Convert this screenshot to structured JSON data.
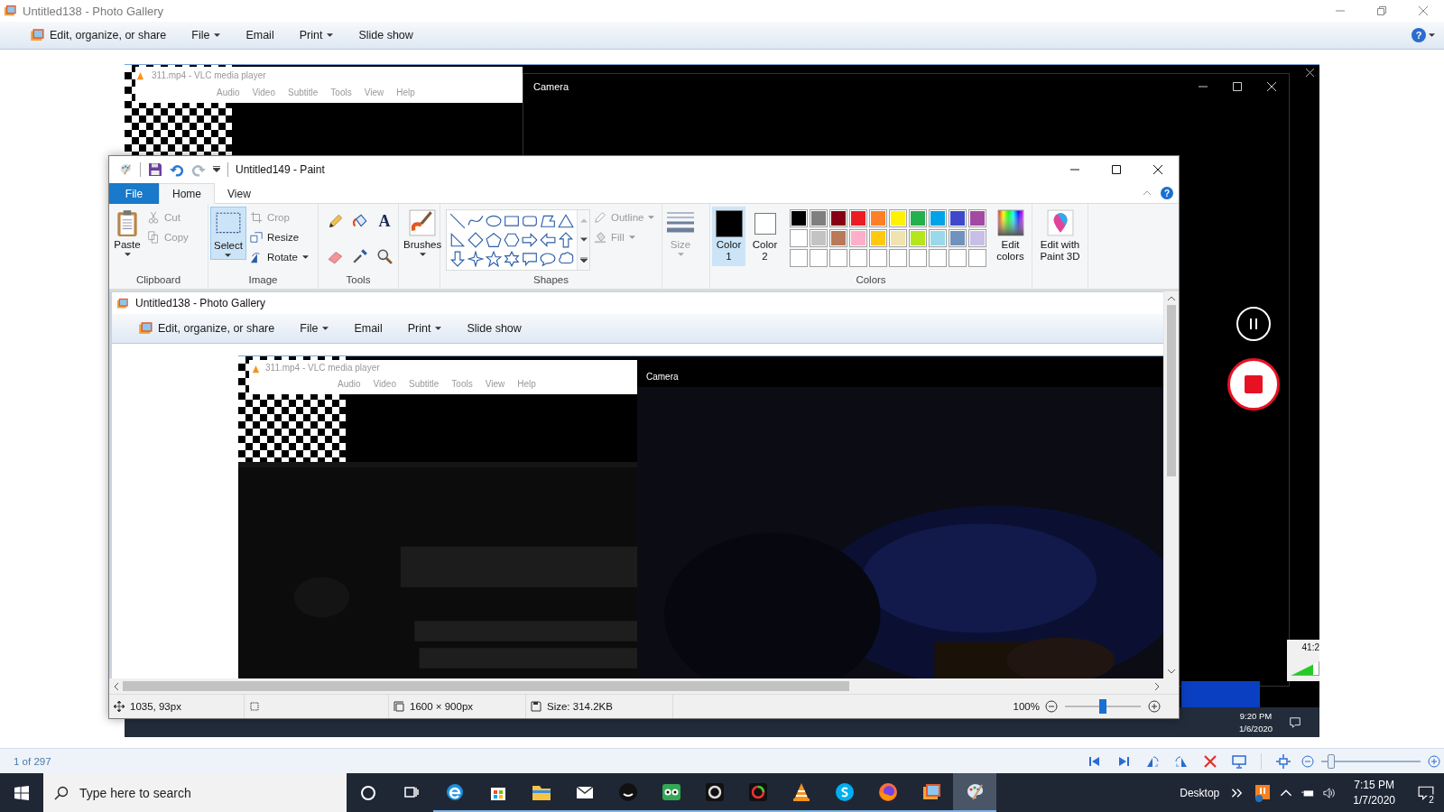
{
  "gallery": {
    "title": "Untitled138 - Photo Gallery",
    "help": "?",
    "counter": "1 of 297",
    "zoom": {
      "level": 0.1
    },
    "menu": [
      {
        "label": "Edit, organize, or share",
        "kind": "icon"
      },
      {
        "label": "File",
        "kind": "dropdown"
      },
      {
        "label": "Email",
        "kind": "plain"
      },
      {
        "label": "Print",
        "kind": "dropdown"
      },
      {
        "label": "Slide show",
        "kind": "plain"
      }
    ]
  },
  "screenshot": {
    "vlc": {
      "title": "311.mp4 - VLC media player",
      "menu": [
        "Audio",
        "Video",
        "Subtitle",
        "Tools",
        "View",
        "Help"
      ],
      "time": "41:2",
      "volume": {
        "level": 0.8
      }
    },
    "camera": {
      "title": "Camera"
    },
    "clock": {
      "time": "9:20 PM",
      "date": "1/6/2020"
    }
  },
  "paint": {
    "title": "Untitled149 - Paint",
    "help": "?",
    "tabs": [
      {
        "label": "File",
        "kind": "file",
        "selected": false
      },
      {
        "label": "Home",
        "kind": "tab",
        "selected": true
      },
      {
        "label": "View",
        "kind": "tab",
        "selected": false
      }
    ],
    "clipboard": {
      "group": "Clipboard",
      "paste": "Paste",
      "actions": [
        {
          "label": "Cut",
          "disabled": true
        },
        {
          "label": "Copy",
          "disabled": true
        }
      ]
    },
    "image": {
      "group": "Image",
      "select": {
        "label": "Select",
        "selected": true
      },
      "actions": [
        {
          "label": "Crop",
          "disabled": true
        },
        {
          "label": "Resize",
          "disabled": false
        },
        {
          "label": "Rotate",
          "disabled": false
        }
      ]
    },
    "tools": {
      "group": "Tools",
      "text_tool": "A"
    },
    "brushes": "Brushes",
    "shapes": {
      "group": "Shapes",
      "outline": {
        "label": "Outline",
        "disabled": true
      },
      "fill": {
        "label": "Fill",
        "disabled": true
      }
    },
    "size": {
      "label": "Size",
      "disabled": true
    },
    "colors": {
      "group": "Colors",
      "edit": "Edit colors",
      "slots": [
        {
          "label": "Color 1",
          "color": "#000000",
          "selected": true
        },
        {
          "label": "Color 2",
          "color": "#ffffff",
          "selected": false
        }
      ],
      "palette": [
        {
          "color": "#000000"
        },
        {
          "color": "#7f7f7f"
        },
        {
          "color": "#880015"
        },
        {
          "color": "#ed1c24"
        },
        {
          "color": "#ff7f27"
        },
        {
          "color": "#fff200"
        },
        {
          "color": "#22b14c"
        },
        {
          "color": "#00a2e8"
        },
        {
          "color": "#3f48cc"
        },
        {
          "color": "#a349a4"
        },
        {
          "color": "#ffffff"
        },
        {
          "color": "#c3c3c3"
        },
        {
          "color": "#b97a57"
        },
        {
          "color": "#ffaec9"
        },
        {
          "color": "#ffc90e"
        },
        {
          "color": "#efe4b0"
        },
        {
          "color": "#b5e61d"
        },
        {
          "color": "#99d9ea"
        },
        {
          "color": "#7092be"
        },
        {
          "color": "#c8bfe7"
        }
      ]
    },
    "paint3d": "Edit with Paint 3D",
    "status": {
      "position": "1035, 93px",
      "dimensions": "1600 × 900px",
      "file_size": "Size: 314.2KB",
      "zoom": "100%",
      "zoom_slider": {
        "level": 0.5
      }
    }
  },
  "nested": {
    "title": "Untitled138 - Photo Gallery",
    "menu": [
      {
        "label": "Edit, organize, or share",
        "kind": "icon"
      },
      {
        "label": "File",
        "kind": "dropdown"
      },
      {
        "label": "Email",
        "kind": "plain"
      },
      {
        "label": "Print",
        "kind": "dropdown"
      },
      {
        "label": "Slide show",
        "kind": "plain"
      }
    ],
    "vlc": {
      "title": "311.mp4 - VLC media player",
      "menu": [
        "Audio",
        "Video",
        "Subtitle",
        "Tools",
        "View",
        "Help"
      ]
    },
    "camera": {
      "title": "Camera"
    }
  },
  "taskbar": {
    "search": {
      "placeholder": "Type here to search"
    },
    "desktop": "Desktop",
    "time": "7:15 PM",
    "date": "1/7/2020",
    "notifications": "2"
  }
}
